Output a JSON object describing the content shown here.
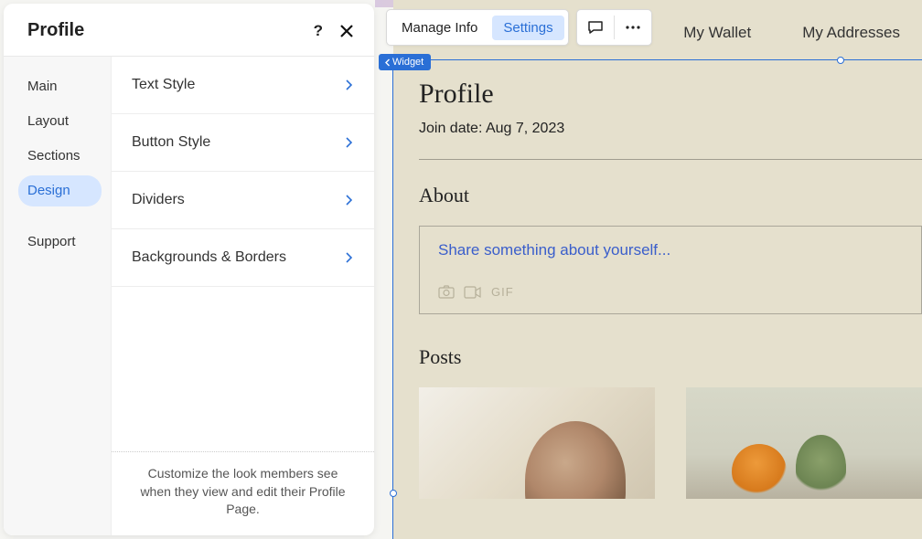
{
  "panel": {
    "title": "Profile",
    "nav": {
      "main": "Main",
      "layout": "Layout",
      "sections": "Sections",
      "design": "Design",
      "support": "Support"
    },
    "options": {
      "text_style": "Text Style",
      "button_style": "Button Style",
      "dividers": "Dividers",
      "backgrounds_borders": "Backgrounds & Borders"
    },
    "footer_text": "Customize the look members see when they view and edit their Profile Page."
  },
  "toolbar": {
    "manage_info": "Manage Info",
    "settings": "Settings"
  },
  "selection": {
    "badge_label": "Widget"
  },
  "preview": {
    "tabs": {
      "wallet": "My Wallet",
      "addresses": "My Addresses"
    },
    "profile_heading": "Profile",
    "join_date": "Join date: Aug 7, 2023",
    "about_heading": "About",
    "about_placeholder": "Share something about yourself...",
    "gif_label": "GIF",
    "posts_heading": "Posts"
  },
  "colors": {
    "accent": "#2a6fd6",
    "preview_bg": "#e5e0cd"
  }
}
